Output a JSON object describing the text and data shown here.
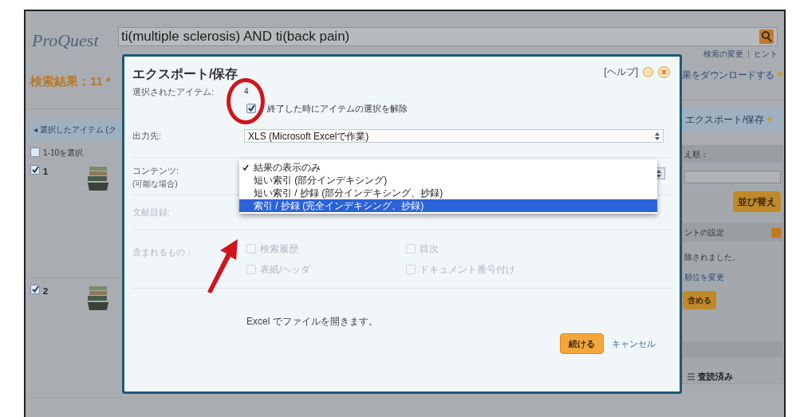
{
  "page": {
    "logo": "ProQuest",
    "search": {
      "value": "ti(multiple sclerosis) AND ti(back pain)"
    },
    "search_links": [
      "検索の変更",
      "ヒント"
    ],
    "results_heading": "検索結果：11 *",
    "download_link": "果をダウンロードする",
    "selected_items_tab": "◂ 選択したアイテム (ク",
    "select_range": "1-10を選択",
    "select_all": {
      "checked": false
    },
    "export_button": "エクスポート/保存",
    "results": [
      {
        "number": "1",
        "selected": true
      },
      {
        "number": "2",
        "selected": true
      }
    ],
    "sidebar": {
      "sort_label": "え順：",
      "sort_button": "並び替え",
      "settings_heading": "ントの設定",
      "message": "除されました。",
      "link": "順位を変更",
      "include_button": "含める",
      "filter": "査読済み"
    }
  },
  "dialog": {
    "title": "エクスポート/保存",
    "help": "[ヘルプ]",
    "selected_label": "選択されたアイテム:",
    "selected_count": "4",
    "deselect": {
      "label": "終了した時にアイテムの選択を解除",
      "checked": true
    },
    "output_label": "出力先:",
    "output_value": "XLS (Microsoft Excelで作業)",
    "content_label": "コンテンツ:",
    "content_note": "(可能な場合)",
    "content_options": [
      {
        "label": "結果の表示のみ",
        "checked": true,
        "selected": false
      },
      {
        "label": "短い索引 (部分インデキシング)",
        "checked": false,
        "selected": false
      },
      {
        "label": "短い索引 / 抄録 (部分インデキシング、抄録)",
        "checked": false,
        "selected": false
      },
      {
        "label": "索引 / 抄録 (完全インデキシング、抄録)",
        "checked": false,
        "selected": true
      }
    ],
    "bibliography_label": "文献目録:",
    "includes_label": "含まれるもの：",
    "includes": [
      {
        "label": "検索履歴",
        "checked": false,
        "disabled": true
      },
      {
        "label": "表紙/ヘッダ",
        "checked": false,
        "disabled": true
      },
      {
        "label": "目次",
        "checked": false,
        "disabled": true
      },
      {
        "label": "ドキュメント番号付け",
        "checked": false,
        "disabled": true
      }
    ],
    "note": "Excel でファイルを開きます。",
    "continue_button": "続ける",
    "cancel_button": "キャンセル"
  }
}
